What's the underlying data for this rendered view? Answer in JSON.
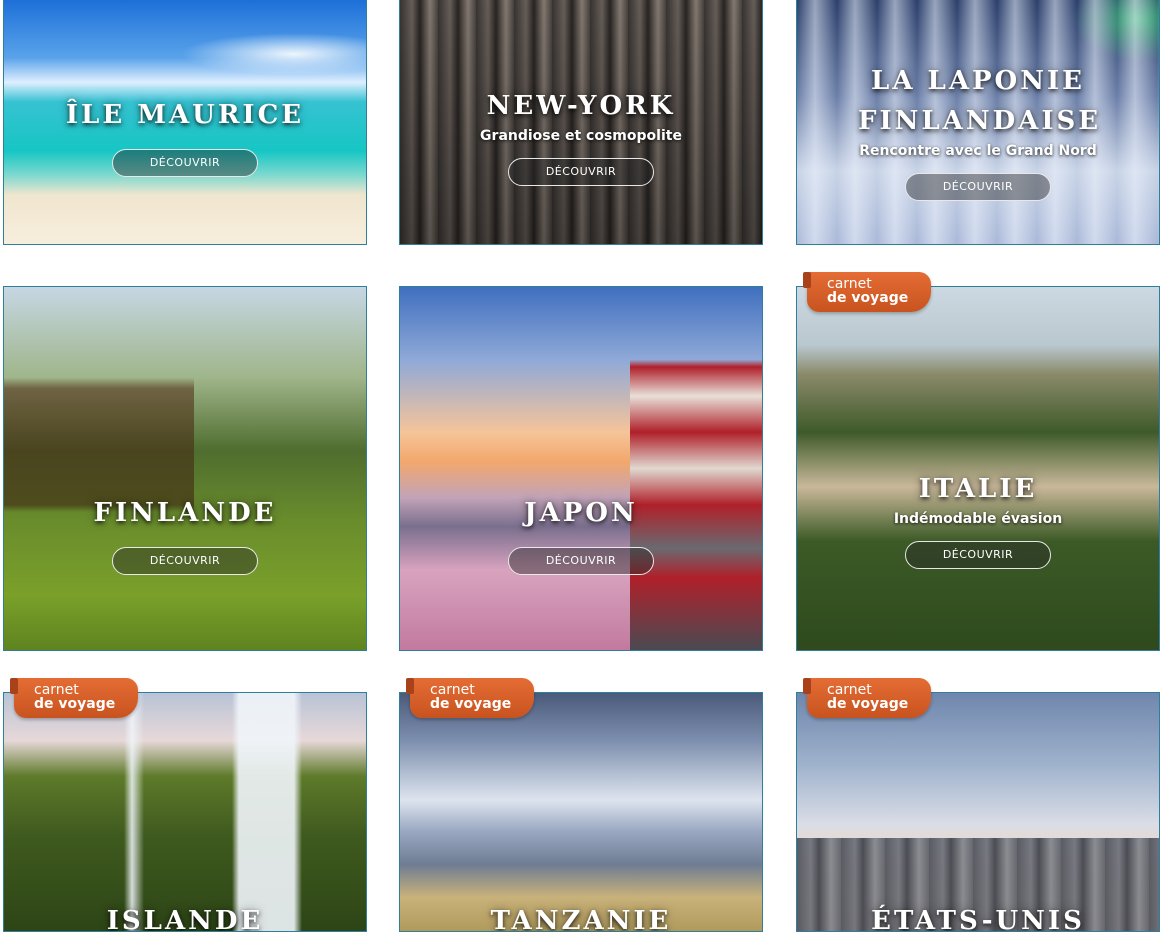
{
  "button_label": "DÉCOUVRIR",
  "badge": {
    "line1": "carnet",
    "line2": "de voyage"
  },
  "colors": {
    "badge_orange": "#d9612a",
    "card_border": "#2f7f9c"
  },
  "cards": [
    {
      "title": "ÎLE MAURICE",
      "subtitle": "",
      "badge": false
    },
    {
      "title": "NEW-YORK",
      "subtitle": "Grandiose et cosmopolite",
      "badge": false
    },
    {
      "title": "LA LAPONIE FINLANDAISE",
      "subtitle": "Rencontre avec le Grand Nord",
      "badge": false
    },
    {
      "title": "FINLANDE",
      "subtitle": "",
      "badge": false
    },
    {
      "title": "JAPON",
      "subtitle": "",
      "badge": false
    },
    {
      "title": "ITALIE",
      "subtitle": "Indémodable évasion",
      "badge": true
    },
    {
      "title": "ISLANDE",
      "subtitle": "",
      "badge": true
    },
    {
      "title": "TANZANIE",
      "subtitle": "",
      "badge": true
    },
    {
      "title": "ÉTATS-UNIS",
      "subtitle": "",
      "badge": true
    }
  ]
}
